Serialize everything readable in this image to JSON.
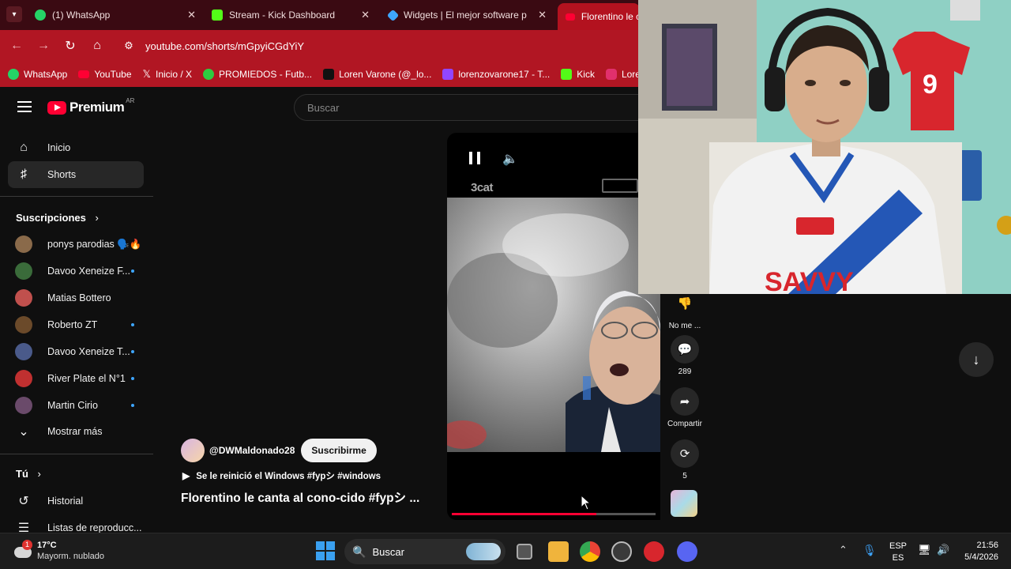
{
  "browser": {
    "tabs": [
      {
        "title": "(1) WhatsApp",
        "color": "#25d366"
      },
      {
        "title": "Stream - Kick Dashboard",
        "color": "#53fc18"
      },
      {
        "title": "Widgets | El mejor software par",
        "color": "#3ea6ff"
      },
      {
        "title": "Florentino le c",
        "color": "#ff0033",
        "active": true
      }
    ],
    "url": "youtube.com/shorts/mGpyiCGdYiY",
    "bookmarks": [
      {
        "label": "WhatsApp",
        "color": "#25d366"
      },
      {
        "label": "YouTube",
        "color": "#ff0033"
      },
      {
        "label": "Inicio / X",
        "color": "#000000"
      },
      {
        "label": "PROMIEDOS - Futb...",
        "color": "#2ecc40"
      },
      {
        "label": "Loren Varone (@_lo...",
        "color": "#111111"
      },
      {
        "label": "lorenzovarone17 - T...",
        "color": "#9146ff"
      },
      {
        "label": "Kick",
        "color": "#53fc18"
      },
      {
        "label": "Lorenz",
        "color": "#e1306c"
      }
    ]
  },
  "youtube": {
    "logo_text": "Premium",
    "region": "AR",
    "search_placeholder": "Buscar",
    "nav": [
      {
        "label": "Inicio",
        "icon": "home-icon"
      },
      {
        "label": "Shorts",
        "icon": "shorts-icon",
        "selected": true
      }
    ],
    "subscriptions_title": "Suscripciones",
    "subscriptions": [
      {
        "name": "ponys parodias 🗣️🔥",
        "color": "#8a6a4a",
        "new": false
      },
      {
        "name": "Davoo Xeneize F...",
        "color": "#3a6b3a",
        "new": true
      },
      {
        "name": "Matias Bottero",
        "color": "#c0504d",
        "new": false
      },
      {
        "name": "Roberto ZT",
        "color": "#6b4a2a",
        "new": true
      },
      {
        "name": "Davoo Xeneize T...",
        "color": "#4a5a8a",
        "new": true
      },
      {
        "name": "River Plate el N°1",
        "color": "#c03030",
        "new": true
      },
      {
        "name": "Martin Cirio",
        "color": "#6a4a6a",
        "new": true
      }
    ],
    "show_more": "Mostrar más",
    "you_title": "Tú",
    "you_items": [
      {
        "label": "Historial",
        "icon": "history-icon"
      },
      {
        "label": "Listas de reproducc...",
        "icon": "playlist-icon"
      }
    ],
    "short": {
      "channel": "@DWMaldonado28",
      "subscribe_label": "Suscribirme",
      "music": "Se le reinició el Windows #fypシ #windows",
      "title": "Florentino le canta al cono-cido #fypシ ...",
      "watermark_left": "3cat",
      "progress": 0.71,
      "actions": [
        {
          "label": "No me ...",
          "icon": "dislike-icon"
        },
        {
          "label": "289",
          "icon": "comment-icon"
        },
        {
          "label": "Compartir",
          "icon": "share-icon"
        },
        {
          "label": "5",
          "icon": "remix-icon"
        }
      ]
    }
  },
  "taskbar": {
    "weather_temp": "17°C",
    "weather_desc": "Mayorm. nublado",
    "weather_badge": "1",
    "search_label": "Buscar",
    "lang_top": "ESP",
    "lang_bottom": "ES",
    "time": "21:56",
    "date": "5/4/2026"
  }
}
